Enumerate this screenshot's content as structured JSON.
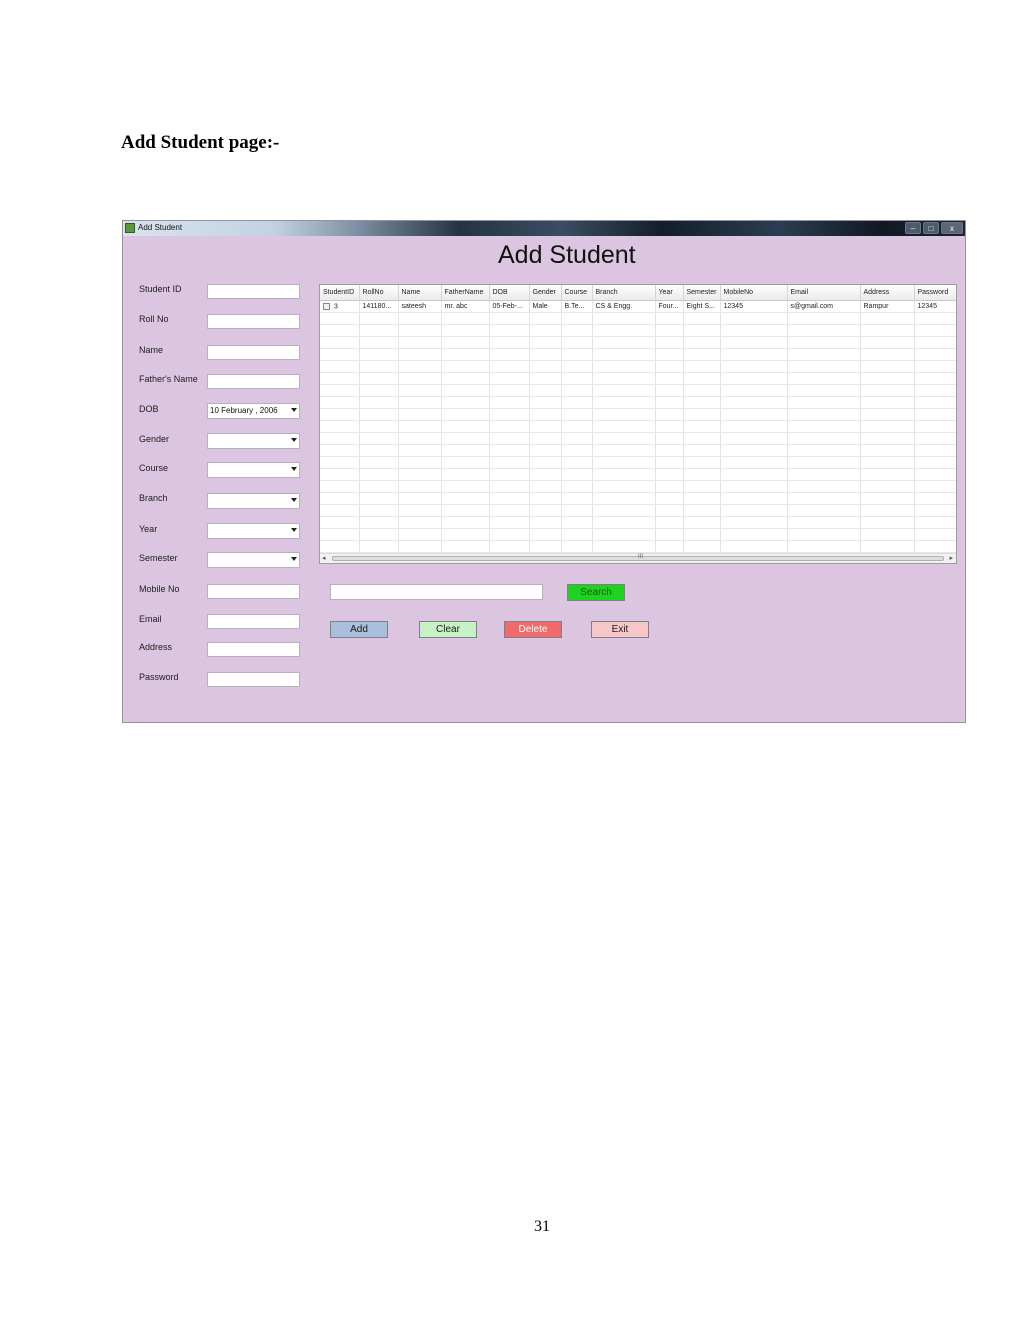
{
  "document": {
    "heading": "Add Student page:-",
    "page_number": "31"
  },
  "window": {
    "title": "Add Student",
    "form_title": "Add Student",
    "controls": {
      "minimize": "–",
      "maximize": "□",
      "close": "x"
    }
  },
  "form": {
    "labels": {
      "student_id": "Student ID",
      "roll_no": "Roll No",
      "name": "Name",
      "fathers_name": "Father's Name",
      "dob": "DOB",
      "gender": "Gender",
      "course": "Course",
      "branch": "Branch",
      "year": "Year",
      "semester": "Semester",
      "mobile_no": "Mobile No",
      "email": "Email",
      "address": "Address",
      "password": "Password"
    },
    "dob_value": "10  February  , 2006"
  },
  "grid": {
    "columns": [
      "StudentID",
      "RollNo",
      "Name",
      "FatherName",
      "DOB",
      "Gender",
      "Course",
      "Branch",
      "Year",
      "Semester",
      "MobileNo",
      "Email",
      "Address",
      "Password"
    ],
    "rows": [
      [
        "3",
        "141180...",
        "sateesh",
        "mr. abc",
        "05-Feb-...",
        "Male",
        "B.Te...",
        "CS & Engg.",
        "Four...",
        "Eight S...",
        "12345",
        "s@gmail.com",
        "Rampur",
        "12345"
      ]
    ],
    "scroll_grip": "III"
  },
  "actions": {
    "search": "Search",
    "add": "Add",
    "clear": "Clear",
    "delete": "Delete",
    "exit": "Exit"
  }
}
